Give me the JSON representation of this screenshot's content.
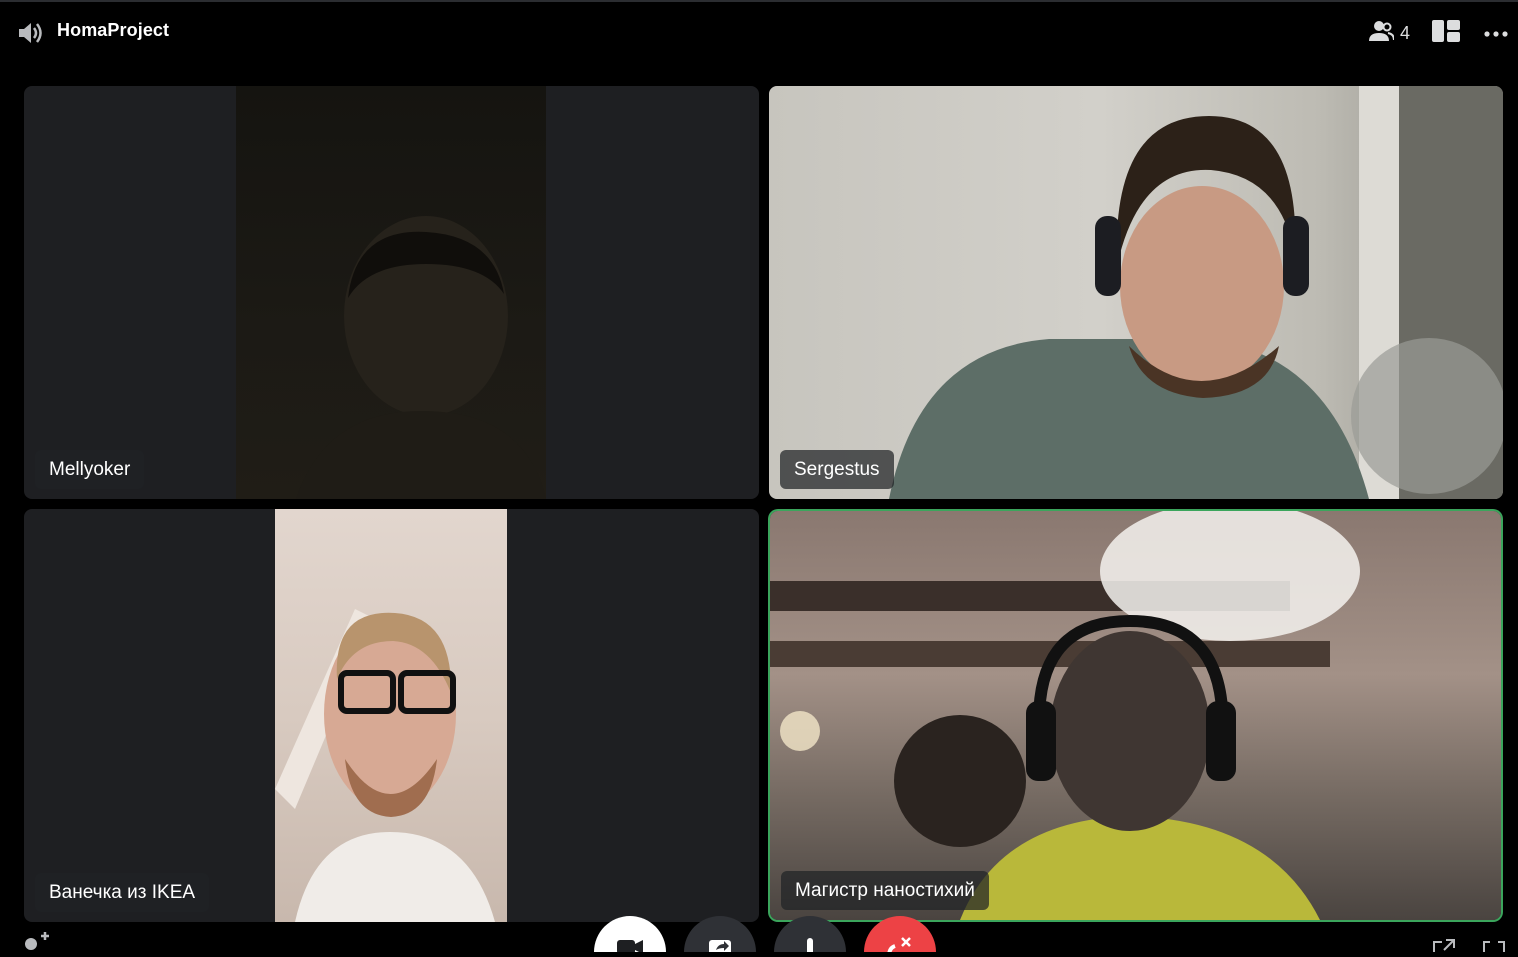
{
  "header": {
    "channel_name": "HomaProject",
    "participant_count": "4"
  },
  "participants": [
    {
      "name": "Mellyoker"
    },
    {
      "name": "Sergestus"
    },
    {
      "name": "Ванечка из IKEA"
    },
    {
      "name": "Магистр наностихий",
      "speaking": true
    }
  ],
  "colors": {
    "speaking_border": "#3ba55c",
    "end_call": "#ed4245",
    "tile_background": "#1e1f22"
  },
  "icons": [
    "speaker-icon",
    "people-icon",
    "grid-layout-icon",
    "more-icon",
    "add-person-icon",
    "camera-icon",
    "screen-share-icon",
    "microphone-icon",
    "end-call-icon",
    "popout-icon",
    "fullscreen-icon"
  ]
}
